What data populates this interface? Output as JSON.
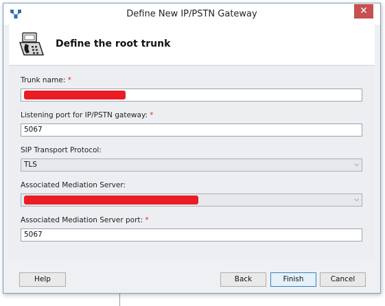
{
  "window": {
    "title": "Define New IP/PSTN Gateway",
    "close_glyph": "✕"
  },
  "header": {
    "title": "Define the root trunk",
    "icon": "fax-phone-icon"
  },
  "form": {
    "trunk_name": {
      "label": "Trunk name:",
      "required_mark": "*",
      "value": ""
    },
    "listening_port": {
      "label": "Listening port for IP/PSTN gateway:",
      "required_mark": "*",
      "value": "5067"
    },
    "sip_transport": {
      "label": "SIP Transport Protocol:",
      "selected": "TLS"
    },
    "mediation_server": {
      "label": "Associated Mediation Server:",
      "selected": ""
    },
    "mediation_port": {
      "label": "Associated Mediation Server port:",
      "required_mark": "*",
      "value": "5067"
    }
  },
  "buttons": {
    "help": "Help",
    "back": "Back",
    "finish": "Finish",
    "cancel": "Cancel"
  },
  "colors": {
    "redaction": "#ea1c24",
    "required": "#e0242b",
    "close_button": "#c75050"
  }
}
